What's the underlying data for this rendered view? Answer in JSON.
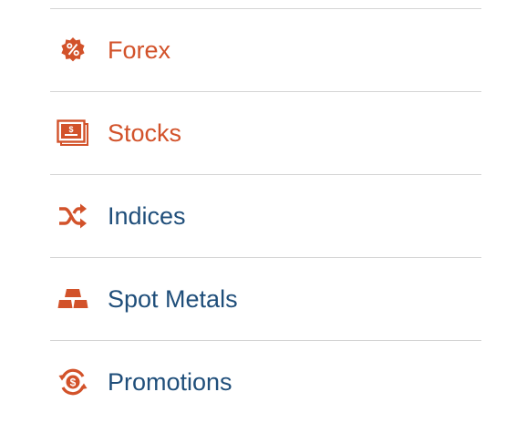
{
  "menu": {
    "accent_color": "#d2522a",
    "text_color": "#1f4e7a",
    "items": [
      {
        "label": "Forex",
        "icon": "percent-badge-icon",
        "active": true
      },
      {
        "label": "Stocks",
        "icon": "stock-certificate-icon",
        "active": true
      },
      {
        "label": "Indices",
        "icon": "shuffle-arrows-icon",
        "active": false
      },
      {
        "label": "Spot Metals",
        "icon": "gold-bars-icon",
        "active": false
      },
      {
        "label": "Promotions",
        "icon": "dollar-cycle-icon",
        "active": false
      }
    ]
  }
}
